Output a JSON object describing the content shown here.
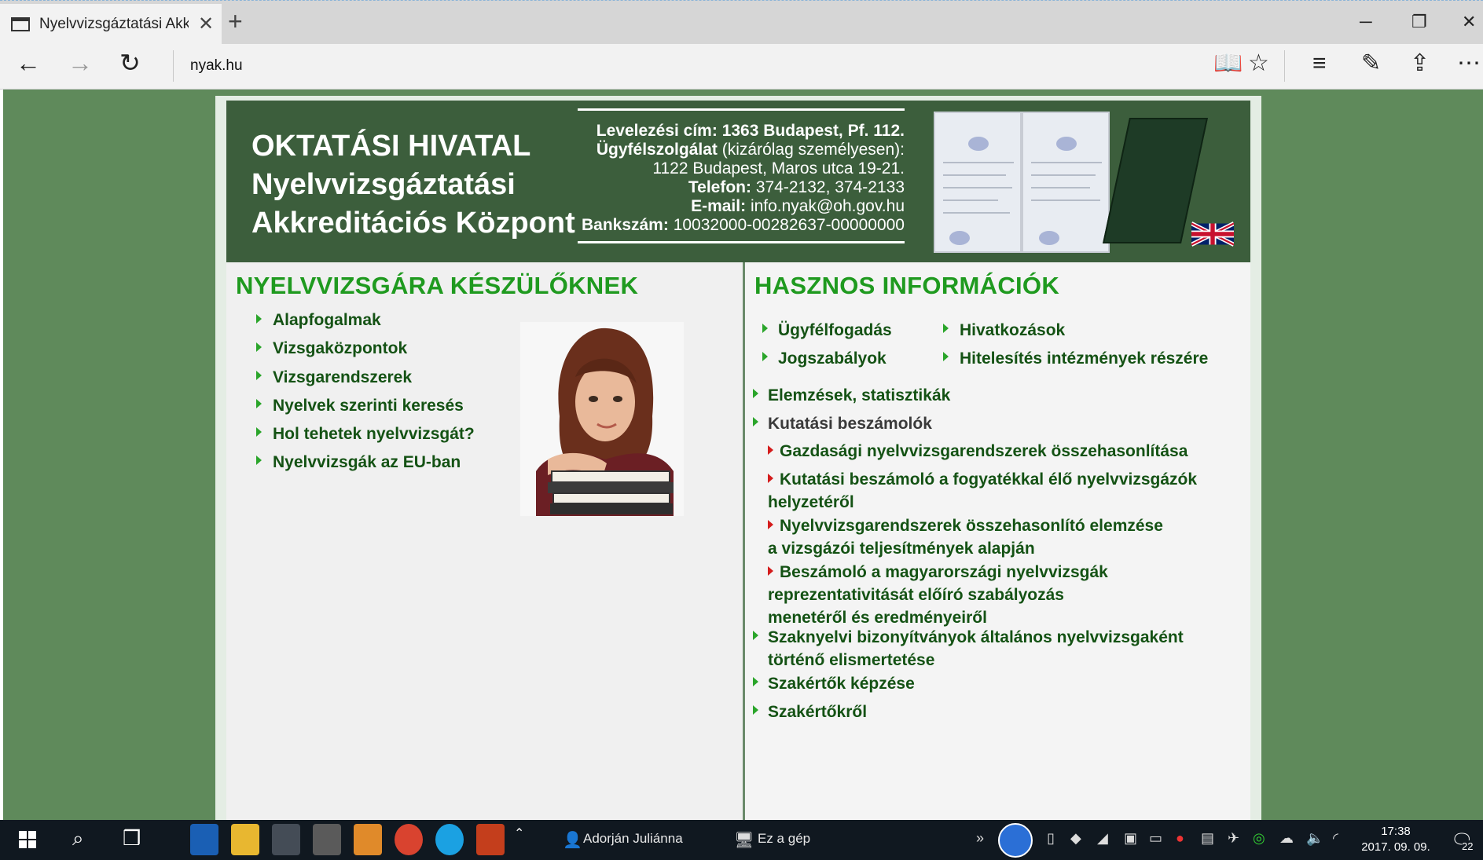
{
  "browser": {
    "tab_title": "Nyelvvizsgáztatási Akkre",
    "url": "nyak.hu"
  },
  "header": {
    "org_line1": "OKTATÁSI HIVATAL",
    "org_line2": "Nyelvvizsgáztatási",
    "org_line3": "Akkreditációs Központ",
    "postal_label": "Levelezési cím:",
    "postal_value": "1363 Budapest, Pf. 112.",
    "service_label": "Ügyfélszolgálat",
    "service_note": "(kizárólag személyesen):",
    "service_address": "1122 Budapest, Maros utca 19-21.",
    "phone_label": "Telefon:",
    "phone_value": "374-2132, 374-2133",
    "email_label": "E-mail:",
    "email_value": "info.nyak@oh.gov.hu",
    "bank_label": "Bankszám:",
    "bank_value": "10032000-00282637-00000000"
  },
  "left": {
    "title": "NYELVVIZSGÁRA KÉSZÜLŐKNEK",
    "items": [
      "Alapfogalmak",
      "Vizsgaközpontok",
      "Vizsgarendszerek",
      "Nyelvek szerinti keresés",
      "Hol tehetek nyelvvizsgát?",
      "Nyelvvizsgák az EU-ban"
    ]
  },
  "right": {
    "title": "HASZNOS INFORMÁCIÓK",
    "grid_items": [
      "Ügyfélfogadás",
      "Hivatkozások",
      "Jogszabályok",
      "Hitelesítés intézmények részére"
    ],
    "elemzesek": "Elemzések, statisztikák",
    "kutatasi": "Kutatási beszámolók",
    "sub1": "Gazdasági nyelvvizsgarendszerek összehasonlítása",
    "sub2_a": "Kutatási beszámoló a fogyatékkal élő nyelvvizsgázók",
    "sub2_b": "helyzetéről",
    "sub3_a": "Nyelvvizsgarendszerek összehasonlító elemzése",
    "sub3_b": "a vizsgázói teljesítmények alapján",
    "sub4_a": "Beszámoló a magyarországi nyelvvizsgák",
    "sub4_b": "reprezentativitását előíró szabályozás",
    "sub4_c": "menetéről és eredményeiről",
    "szaknyelvi_a": "Szaknyelvi bizonyítványok általános nyelvvizsgaként",
    "szaknyelvi_b": "történő elismertetése",
    "szakertok_kepzese": "Szakértők képzése",
    "szakertokrol": "Szakértőkről"
  },
  "taskbar": {
    "window1": "Adorján Juliánna",
    "window2": "Ez a gép",
    "time": "17:38",
    "date": "2017. 09. 09.",
    "notifications": "22"
  },
  "colors": {
    "page_bg": "#5f8a5b",
    "header_bg": "#3c5e3c",
    "title_green": "#1f9a1f",
    "link_green": "#145214",
    "bullet_red": "#d41c1c"
  }
}
